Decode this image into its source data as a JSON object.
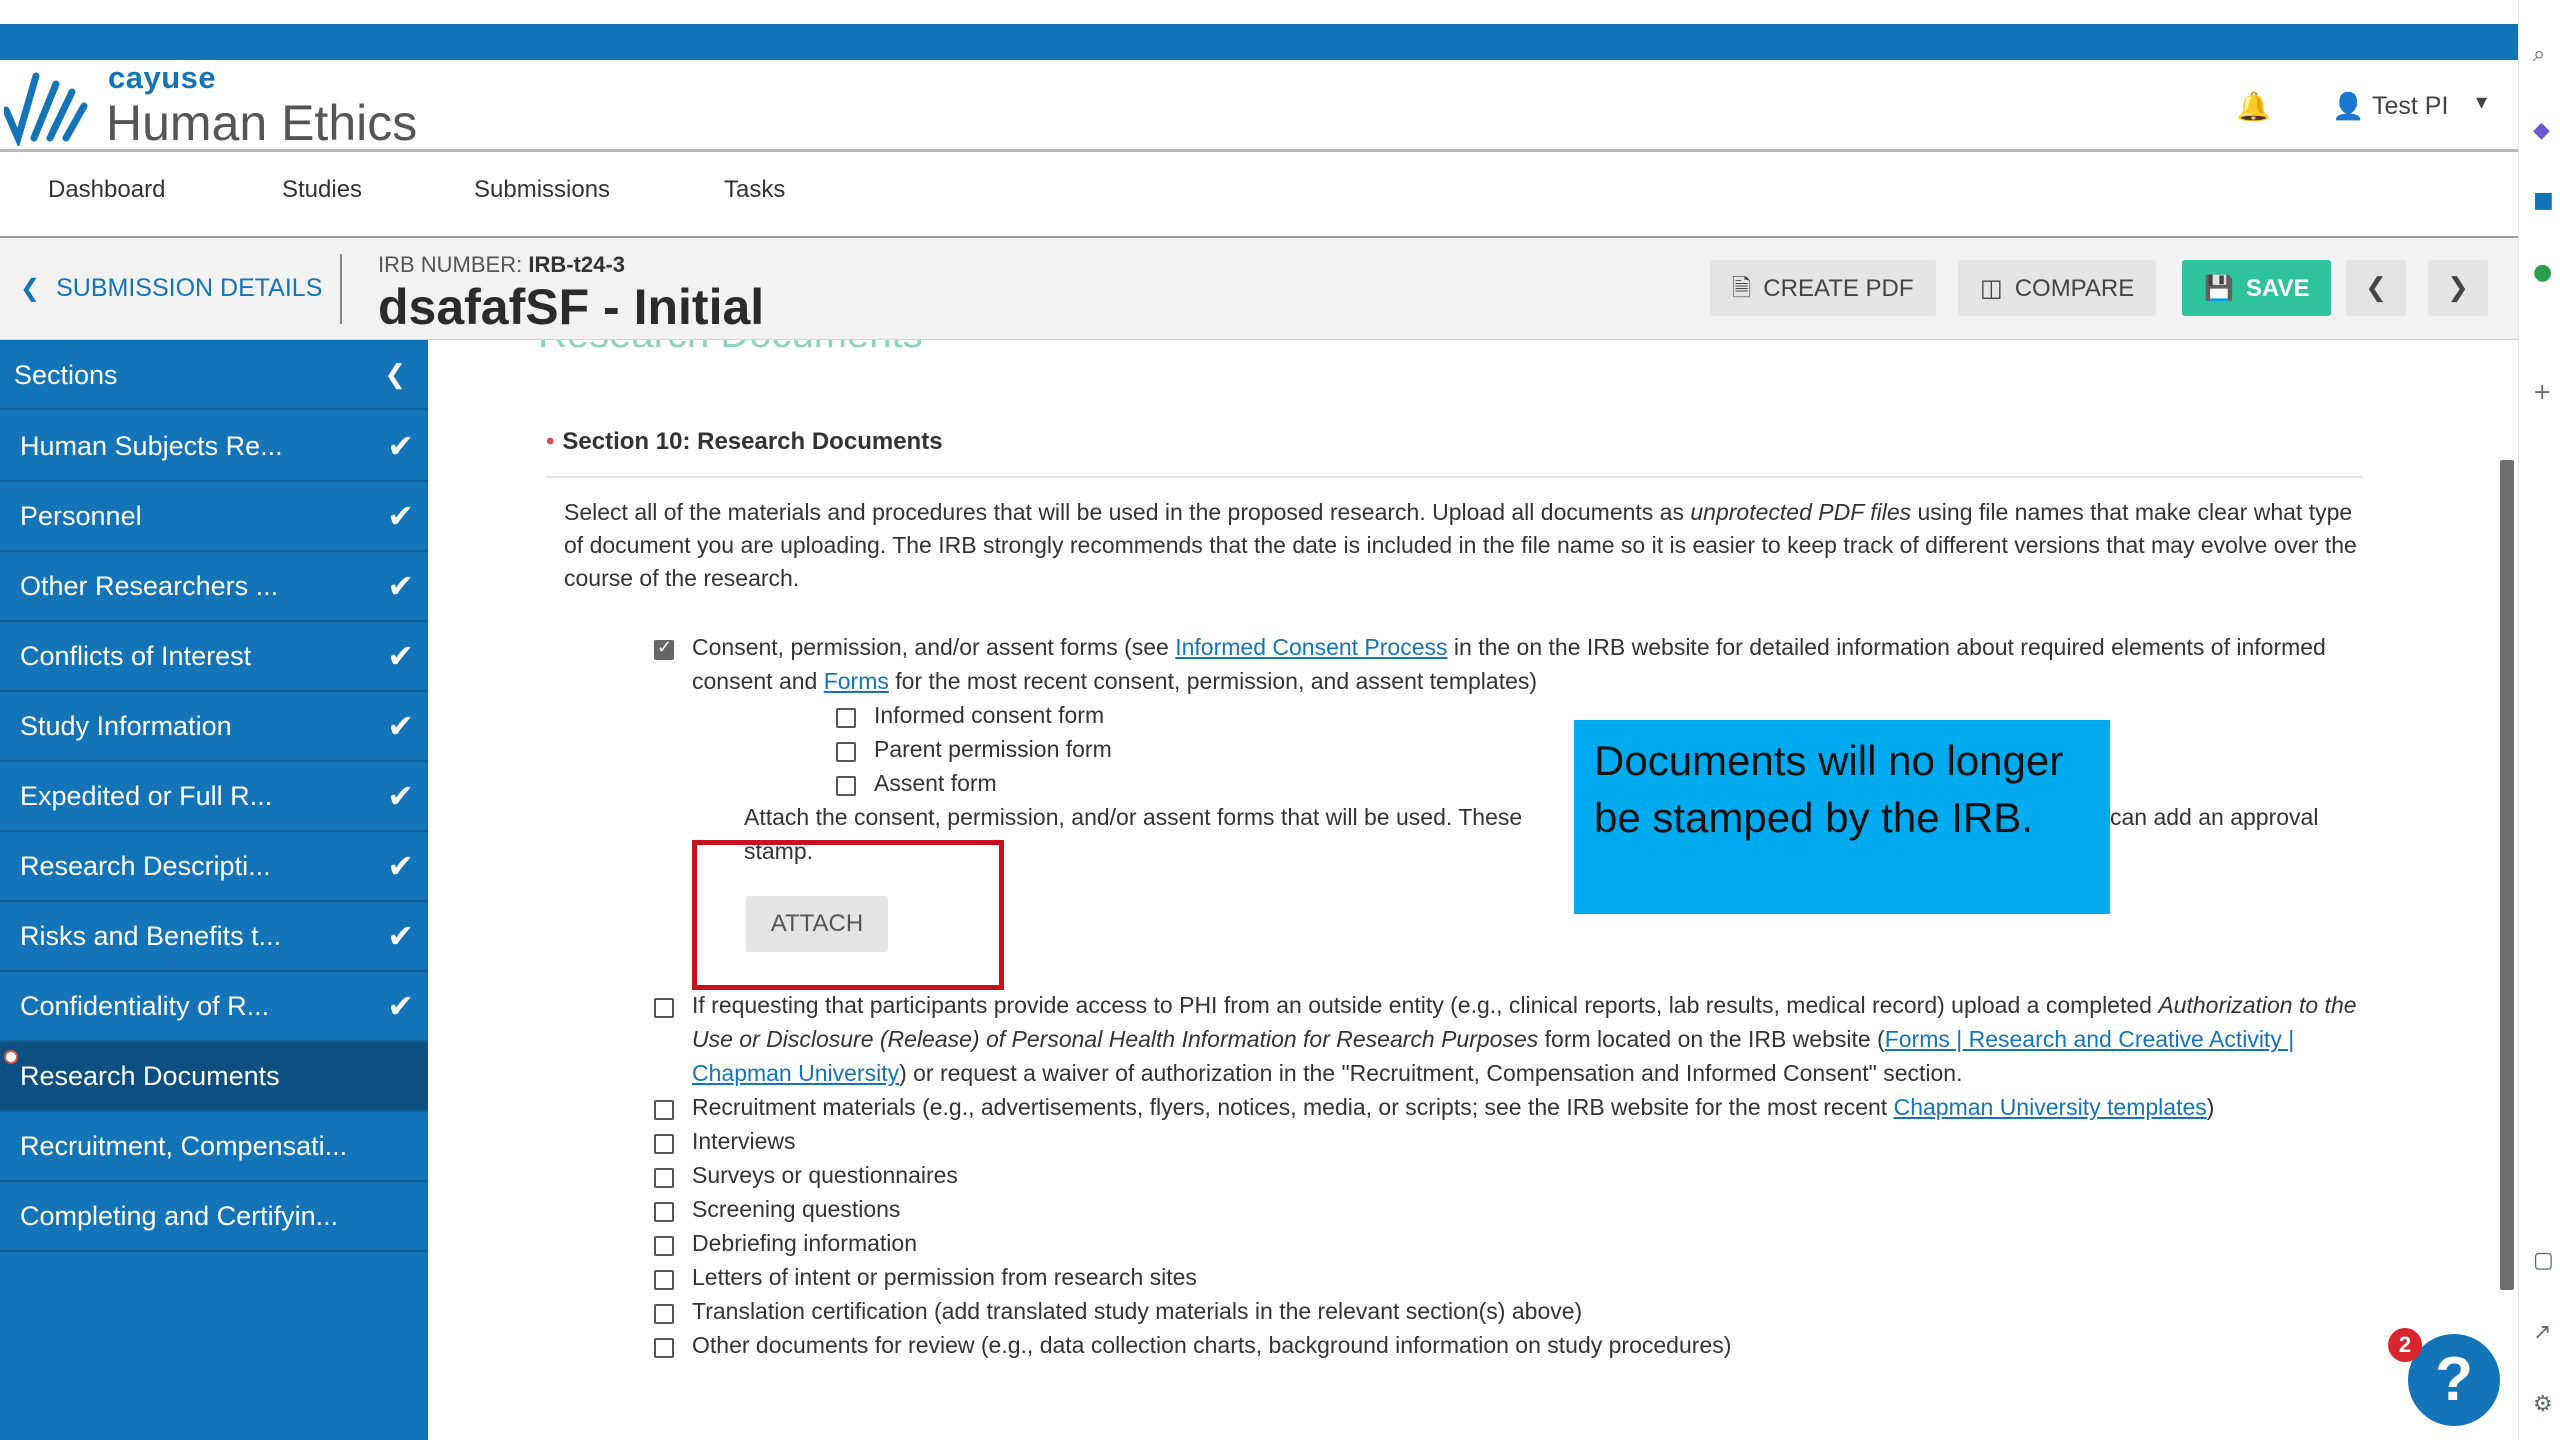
{
  "header": {
    "brand": "cayuse",
    "product": "Human Ethics",
    "user_name": "Test PI"
  },
  "nav": {
    "items": [
      {
        "label": "Dashboard"
      },
      {
        "label": "Studies"
      },
      {
        "label": "Submissions"
      },
      {
        "label": "Tasks"
      }
    ]
  },
  "subheader": {
    "back_label": "SUBMISSION DETAILS",
    "irb_label": "IRB NUMBER:",
    "irb_number": "IRB-t24-3",
    "title": "dsafafSF - Initial",
    "create_pdf": "CREATE PDF",
    "compare": "COMPARE",
    "save": "SAVE"
  },
  "sidebar": {
    "heading": "Sections",
    "items": [
      {
        "label": "Human Subjects Re...",
        "complete": true
      },
      {
        "label": "Personnel",
        "complete": true
      },
      {
        "label": "Other Researchers ...",
        "complete": true
      },
      {
        "label": "Conflicts of Interest",
        "complete": true
      },
      {
        "label": "Study Information",
        "complete": true
      },
      {
        "label": "Expedited or Full R...",
        "complete": true
      },
      {
        "label": "Research Descripti...",
        "complete": true
      },
      {
        "label": "Risks and Benefits t...",
        "complete": true
      },
      {
        "label": "Confidentiality of R...",
        "complete": true
      },
      {
        "label": "Research Documents",
        "complete": false,
        "active": true
      },
      {
        "label": "Recruitment, Compensati...",
        "complete": false
      },
      {
        "label": "Completing and Certifyin...",
        "complete": false
      }
    ]
  },
  "main": {
    "cut_title": "Research Documents",
    "section_title": "Section 10:  Research Documents",
    "intro_a": "Select all of the materials and procedures that will be used in the proposed research. Upload all documents as ",
    "intro_em": "unprotected PDF files",
    "intro_b": " using file names that make clear what type of document you are uploading. The IRB strongly recommends that the date is included in the file name so it is easier to keep track of different versions that may evolve over the course of the research.",
    "consent": {
      "checked": true,
      "t1": "Consent, permission, and/or assent forms (see ",
      "link1": "Informed Consent Process",
      "t2": " in the on the IRB website for detailed information about required elements of informed consent and  ",
      "link2": "Forms",
      "t3": " for the most recent consent, permission, and assent templates)"
    },
    "sub_options": [
      "Informed consent form",
      "Parent permission form",
      "Assent form"
    ],
    "attach_note_a": "Attach the consent, permission, and/or assent forms that will be used. These",
    "attach_note_b": "can add an approval",
    "attach_note_c": "stamp.",
    "attach_label": "ATTACH",
    "phi": {
      "t1": "If requesting that participants provide access to PHI from an outside entity (e.g., clinical reports, lab results, medical record) upload a completed ",
      "em": "Authorization to the Use or Disclosure (Release) of Personal Health Information for Research Purposes",
      "t2": " form located on the IRB website (",
      "link": "Forms | Research and Creative Activity | Chapman University",
      "t3": ") or request a waiver of authorization in the \"Recruitment, Compensation and Informed Consent\" section."
    },
    "recruit": {
      "t1": "Recruitment materials (e.g., advertisements, flyers, notices, media, or scripts; see the IRB website for the most recent ",
      "link": "Chapman University templates",
      "t2": ")"
    },
    "options": [
      "Interviews",
      "Surveys or questionnaires",
      "Screening questions",
      "Debriefing information",
      "Letters of intent or permission from research sites",
      "Translation certification (add translated study materials in the relevant section(s) above)",
      "Other documents for review (e.g., data collection charts, background information on study procedures)"
    ]
  },
  "callout": {
    "text": "Documents will no longer be stamped by the IRB."
  },
  "help": {
    "badge": "2",
    "label": "?"
  },
  "colors": {
    "brand_blue": "#1474b8",
    "save_green": "#2ec39a",
    "callout_blue": "#00aaee",
    "highlight_red": "#c8101e"
  }
}
